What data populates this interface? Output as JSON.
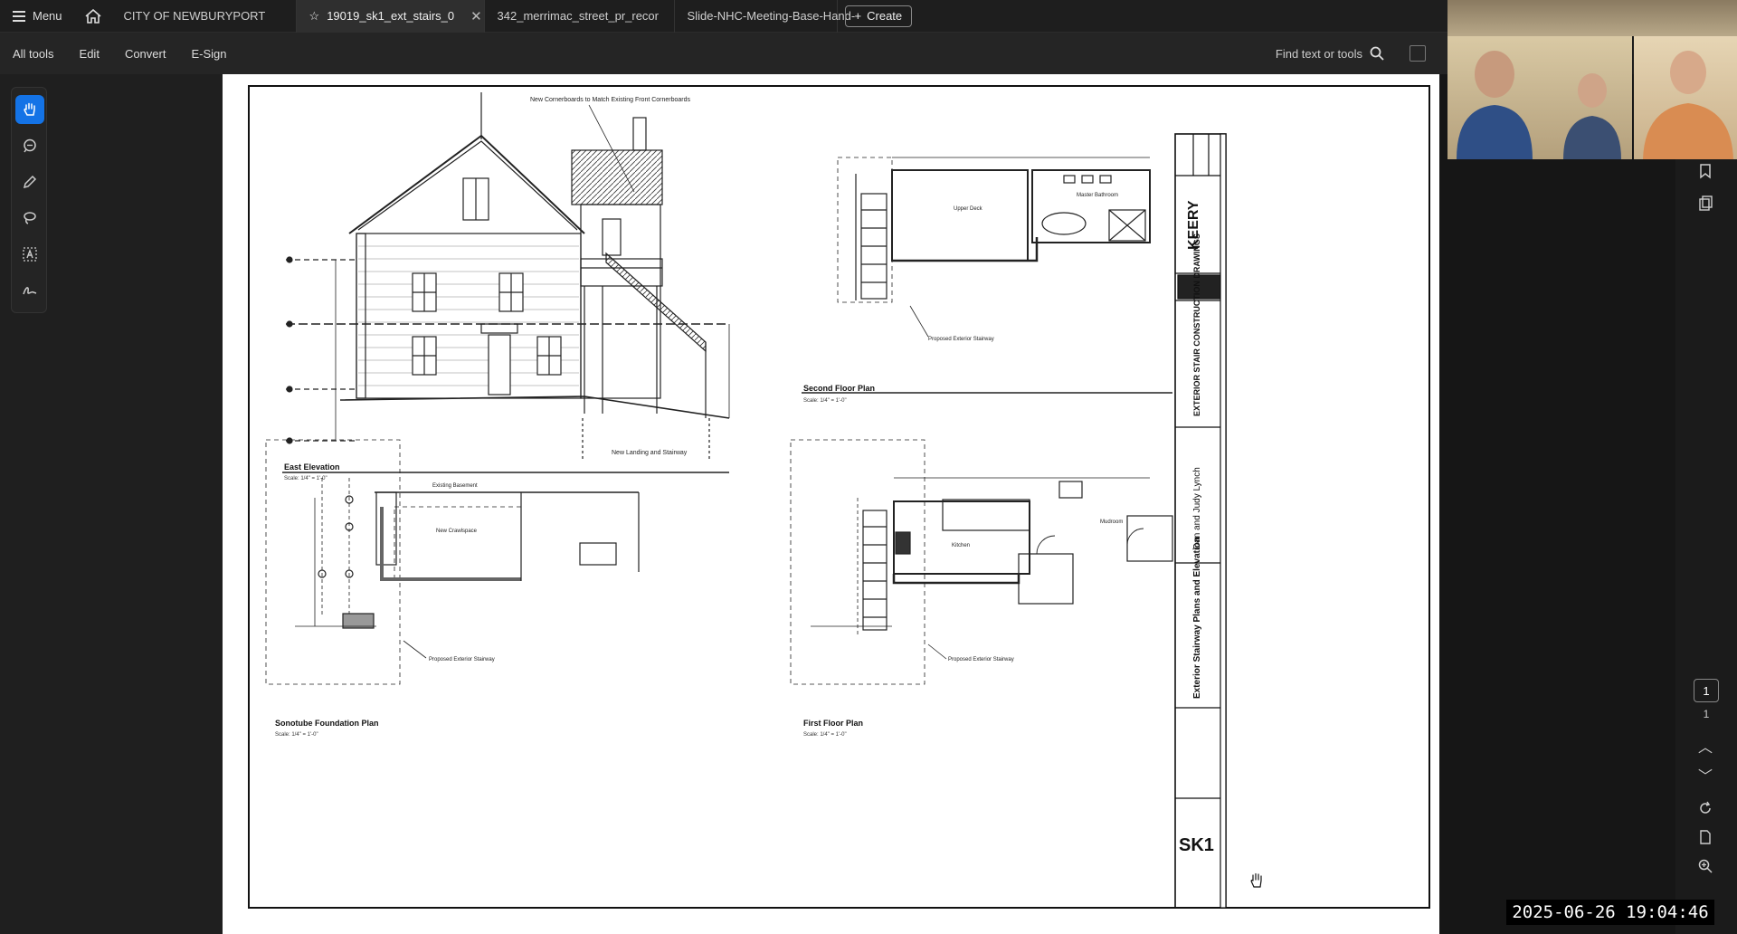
{
  "tabbar": {
    "menu_label": "Menu",
    "tabs": [
      {
        "label": "CITY OF NEWBURYPORT",
        "active": false
      },
      {
        "label": "19019_sk1_ext_stairs_0",
        "active": true
      },
      {
        "label": "342_merrimac_street_pr_recor",
        "active": false
      },
      {
        "label": "Slide-NHC-Meeting-Base-Hand-",
        "active": false
      }
    ],
    "create_label": "Create"
  },
  "toolbar": {
    "items": [
      "All tools",
      "Edit",
      "Convert",
      "E-Sign"
    ],
    "find_label": "Find text or tools"
  },
  "drawing": {
    "east_elevation_title": "East Elevation",
    "east_elevation_scale": "Scale: 1/4\" = 1'-0\"",
    "second_floor_title": "Second Floor Plan",
    "second_floor_scale": "Scale: 1/4\" = 1'-0\"",
    "foundation_title": "Sonotube Foundation Plan",
    "foundation_scale": "Scale: 1/4\" = 1'-0\"",
    "first_floor_title": "First Floor Plan",
    "first_floor_scale": "Scale: 1/4\" = 1'-0\"",
    "note_cornerboards": "New Cornerboards to Match Existing Front Cornerboards",
    "note_landing": "New Landing and Stairway",
    "note_proposed_stair_1": "Proposed Exterior Stairway",
    "note_proposed_stair_2": "Proposed Exterior Stairway",
    "note_proposed_stair_3": "Proposed Exterior Stairway",
    "note_proposed_stair_4": "Proposed Exterior Stairway",
    "room_upper_deck": "Upper Deck",
    "room_master_bathroom": "Master Bathroom",
    "room_existing_basement": "Existing Basement",
    "room_crawlspace": "New Crawlspace",
    "room_kitchen": "Kitchen",
    "room_mudroom": "Mudroom"
  },
  "titleblock": {
    "firm": "KEERY",
    "project_type": "EXTERIOR STAIR CONSTRUCTION DRAWINGS",
    "client": "Dan and Judy Lynch",
    "sheet_title": "Exterior Stairway Plans and Elevation",
    "sheet_number": "SK1"
  },
  "viewer": {
    "current_page": "1",
    "page_count": "1"
  },
  "timestamp": "2025-06-26 19:04:46",
  "colors": {
    "accent": "#1473e6",
    "tabbar_bg": "#1e1e1e",
    "toolbar_bg": "#252525"
  }
}
